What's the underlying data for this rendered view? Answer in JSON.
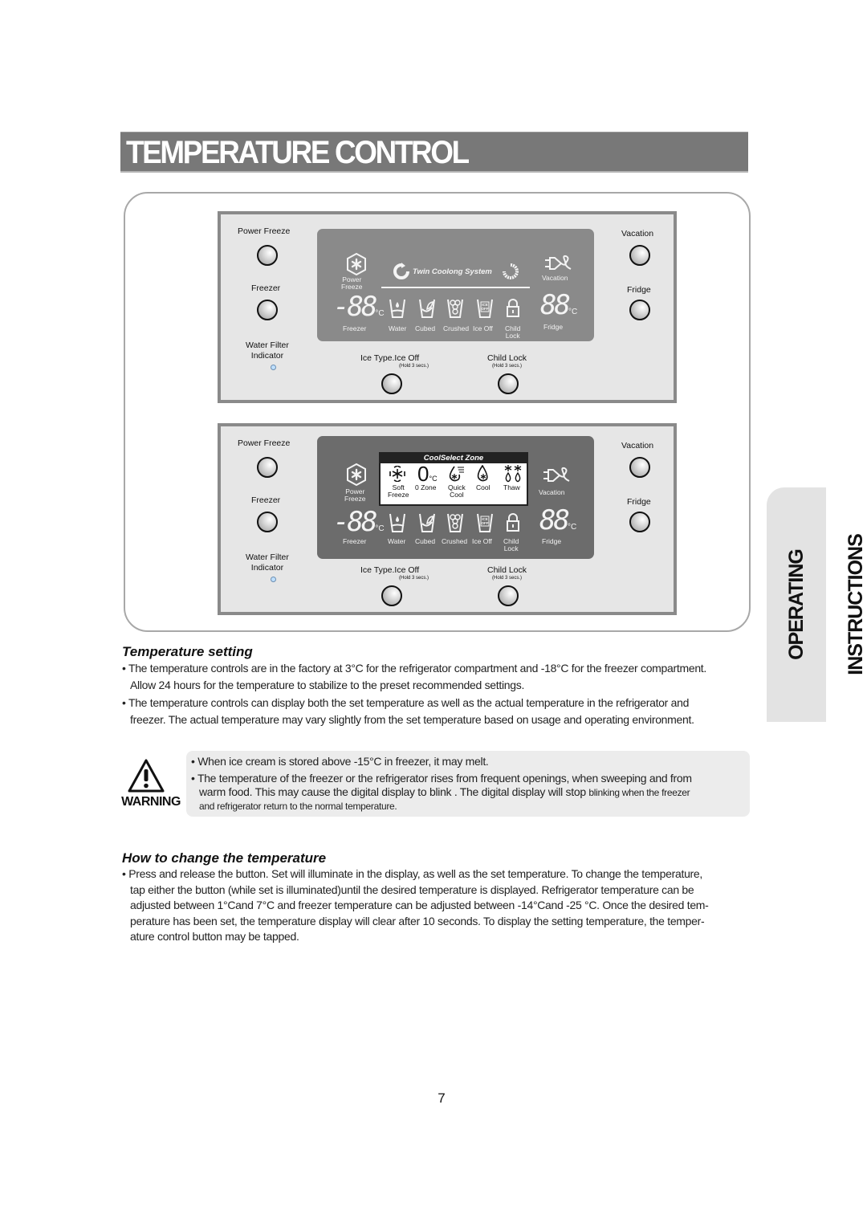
{
  "page": {
    "title": "TEMPERATURE CONTROL",
    "side_tab": "OPERATING INSTRUCTIONS",
    "page_number": "7"
  },
  "panels": [
    {
      "variant": "Twin Coolong System",
      "buttons": {
        "power_freeze": "Power Freeze",
        "freezer": "Freezer",
        "water_filter_line1": "Water Filter",
        "water_filter_line2": "Indicator",
        "ice_type": "Ice Type.Ice Off",
        "ice_type_hold": "(Hold 3 secs.)",
        "child_lock": "Child Lock",
        "child_lock_hold": "(Hold 3 secs.)",
        "vacation": "Vacation",
        "fridge": "Fridge"
      },
      "display": {
        "power_freeze_line1": "Power",
        "power_freeze_line2": "Freeze",
        "twin_label": "Twin Coolong System",
        "freezer_digits": "-88",
        "fridge_digits": "88",
        "unit": "°C",
        "freezer": "Freezer",
        "water": "Water",
        "cubed": "Cubed",
        "crushed": "Crushed",
        "ice_off": "Ice Off",
        "ice_off_glyph_1": "ICE",
        "ice_off_glyph_2": "OFF",
        "child_lock_line1": "Child",
        "child_lock_line2": "Lock",
        "vacation": "Vacation",
        "fridge": "Fridge"
      }
    },
    {
      "variant": "CoolSelect Zone",
      "buttons": {
        "power_freeze": "Power Freeze",
        "freezer": "Freezer",
        "water_filter_line1": "Water Filter",
        "water_filter_line2": "Indicator",
        "ice_type": "Ice Type.Ice Off",
        "ice_type_hold": "(Hold 3 secs.)",
        "child_lock": "Child Lock",
        "child_lock_hold": "(Hold 3 secs.)",
        "vacation": "Vacation",
        "fridge": "Fridge"
      },
      "display": {
        "power_freeze_line1": "Power",
        "power_freeze_line2": "Freeze",
        "coolselect_title": "CoolSelect Zone",
        "soft_freeze_line1": "Soft",
        "soft_freeze_line2": "Freeze",
        "zero_zone_digit": "0",
        "zero_zone_unit": "°C",
        "zero_zone": "0 Zone",
        "quick_cool_line1": "Quick",
        "quick_cool_line2": "Cool",
        "cool": "Cool",
        "thaw": "Thaw",
        "freezer_digits": "-88",
        "fridge_digits": "88",
        "unit": "°C",
        "freezer": "Freezer",
        "water": "Water",
        "cubed": "Cubed",
        "crushed": "Crushed",
        "ice_off": "Ice Off",
        "ice_off_glyph_1": "ICE",
        "ice_off_glyph_2": "OFF",
        "child_lock_line1": "Child",
        "child_lock_line2": "Lock",
        "vacation": "Vacation",
        "fridge": "Fridge"
      }
    }
  ],
  "temperature_setting": {
    "heading": "Temperature setting",
    "bullets": [
      {
        "line1": "• The temperature controls are in the factory at 3°C for the refrigerator compartment and -18°C for the freezer compartment.",
        "line2": "Allow 24 hours for the temperature to stabilize to the preset recommended settings."
      },
      {
        "line1": "• The temperature controls can display both the set temperature as well as the actual temperature in the refrigerator and",
        "line2": "freezer. The actual temperature may vary slightly from the set temperature based on usage and operating environment."
      }
    ]
  },
  "warning": {
    "label": "WARNING",
    "icon": "warning-triangle-icon",
    "bullet1": "• When ice cream is stored above -15°C in freezer, it may melt.",
    "bullet2_line1": "• The temperature of the freezer or the refrigerator rises from frequent openings, when sweeping and from",
    "bullet2_line2a": "warm food. This may cause the digital display to blink . The digital display will stop ",
    "bullet2_line2b": "blinking when the freezer",
    "bullet2_line3": "and refrigerator return to the normal temperature."
  },
  "how_to_change": {
    "heading": "How to change the temperature",
    "lines": [
      "• Press and release the button. Set will illuminate in the display, as well as the set temperature. To change the temperature,",
      "tap either the button (while set is illuminated)until the desired temperature is displayed. Refrigerator temperature can be",
      "adjusted between 1°Cand 7°C and freezer temperature can be adjusted between -14°Cand -25 °C. Once the desired tem-",
      "perature has been set, the temperature display will clear after 10 seconds. To display the setting temperature, the temper-",
      "ature control button may be tapped."
    ]
  }
}
